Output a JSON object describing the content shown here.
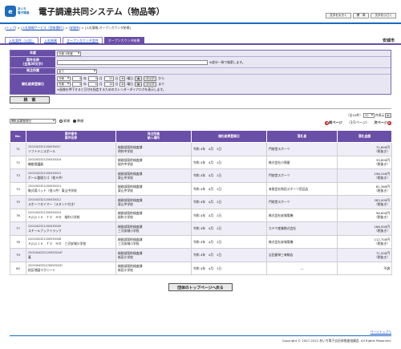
{
  "header": {
    "logo_mark": "e",
    "logo_line1": "あいち",
    "logo_line2": "電子調達",
    "system_title": "電子調達共同システム（物品等）",
    "font_buttons": [
      "文字を大きく",
      "標　準",
      "文字を小さく"
    ]
  },
  "breadcrumb": [
    {
      "label": "トップ",
      "link": true
    },
    {
      "label": "入札情報サービス（団体選択）",
      "link": true
    },
    {
      "label": "安城市",
      "link": true
    },
    {
      "label": "入札情報-オープンカウンタ結果",
      "link": false
    }
  ],
  "tabs": [
    "入札案件（公告）",
    "入札結果",
    "オープンカウンタ案件",
    "オープンカウンタ結果"
  ],
  "org_name": "安城市",
  "search": {
    "rows": [
      {
        "label": "年度",
        "value": "令和 4年度"
      },
      {
        "label": "案件名称\n(全角30文字)",
        "note": "※部分一致で検索します。"
      },
      {
        "label": "発注所属",
        "value": "全て"
      },
      {
        "label": "開札結果登録日",
        "date1": {
          "era": "令和",
          "y": "4",
          "m": "3",
          "d": "31",
          "weekday": "木",
          "suffix": "から"
        },
        "date2": {
          "era": "令和",
          "y": "4",
          "m": "4",
          "d": "14",
          "weekday": "木",
          "suffix": "まで"
        },
        "note": "※画像を押下すると日付を指定するためのカレンダーダイアログを表示します。",
        "clear": "クリア",
        "youbi": "曜日"
      }
    ],
    "button": "検　索"
  },
  "controls": {
    "sort_value": "開札結果登録日",
    "order_labels": [
      "昇順",
      "降順"
    ],
    "per_page_prefix": "（全10件）",
    "per_page_value": "10",
    "per_page_suffix": "件表示",
    "prev": "前ページ",
    "page_info": "（1/1ページ）",
    "next": "次ページ"
  },
  "table": {
    "headers": [
      "No.",
      "案件番号\n案件名称",
      "発注所属\n納入場所",
      "開札結果登録日",
      "落札者",
      "落札金額"
    ],
    "rows": [
      {
        "no": "71",
        "num": "220100232120053301?",
        "name": "ソフトテニスボール",
        "dept": "総務部契約検査課",
        "place": "明祥中学校",
        "date": "令和 4年　4月　1日",
        "winner": "門前堂スポーツ",
        "amount": "72,600円",
        "tax": "（税抜き）"
      },
      {
        "no": "72",
        "num": "2201002321200533016",
        "name": "機能保護器",
        "dept": "総務部契約検査課",
        "place": "桜井中学校",
        "date": "令和 4年　4月　1日",
        "winner": "株式会社小原屋",
        "amount": "39,800円",
        "tax": "（税抜き）"
      },
      {
        "no": "73",
        "num": "2201002321200533015",
        "name": "ボール整理カゴ（他９件）",
        "dept": "総務部契約検査課",
        "place": "東山中学校",
        "date": "令和 4年　4月　1日",
        "winner": "門前堂スポーツ",
        "amount": "196,340円",
        "tax": "（税抜き）"
      },
      {
        "no": "74",
        "num": "2201002321200533013",
        "name": "軟式用バット（他１件）東山中学校",
        "dept": "総務部契約検査課",
        "place": "東山中学校",
        "date": "令和 4年　4月　1日",
        "winner": "有限会社和田スポーツ用品店",
        "amount": "81,360円",
        "tax": "（税抜き）"
      },
      {
        "no": "75",
        "num": "2201002321200533012",
        "name": "スポーツタイマー（スタンド付き）",
        "dept": "総務部契約検査課",
        "place": "東山中学校",
        "date": "令和 4年　4月　1日",
        "winner": "門前堂スポーツ",
        "amount": "283,000円",
        "tax": "（税抜き）"
      },
      {
        "no": "76",
        "num": "2201002321200533010",
        "name": "Ａｐｐｌｅ　ＴＶ　ＨＤ　桜町小学校",
        "dept": "総務部契約検査課",
        "place": "桜町小学校",
        "date": "令和 4年　4月　1日",
        "winner": "株式会社安城電機",
        "amount": "96,600円",
        "tax": "（税抜き）"
      },
      {
        "no": "77",
        "num": "2201002321200533009",
        "name": "スチールブックトラック",
        "dept": "総務部契約検査課",
        "place": "三河安城小学校",
        "date": "令和 4年　4月　1日",
        "winner": "カミヤ産業株式会社",
        "amount": "166,000円",
        "tax": "（税抜き）"
      },
      {
        "no": "78",
        "num": "2201002321200533008",
        "name": "Ａｐｐｌｅ　ＴＶ　ＨＤ　三河安城小学校",
        "dept": "総務部契約検査課",
        "place": "三河安城小学校",
        "date": "令和 4年　4月　1日",
        "winner": "株式会社安城電機",
        "amount": "112,700円",
        "tax": "（税抜き）"
      },
      {
        "no": "79",
        "num": "2201004232120053244?",
        "name": "箒",
        "dept": "総務部契約検査課",
        "place": "新田小学校",
        "date": "令和 4年　4月　1日",
        "winner": "吉田屋琴三味線店",
        "amount": "71,000円",
        "tax": "（税抜き）"
      },
      {
        "no": "80",
        "num": "2201004232120053243?",
        "name": "校区地図マグシート",
        "dept": "総務部契約検査課",
        "place": "新田小学校",
        "date": "令和 4年　4月　1日",
        "winner": "―",
        "amount": "不調",
        "tax": ""
      }
    ]
  },
  "footer": {
    "back_button": "団体のトップページへ戻る",
    "pagetop": "ページトップへ",
    "copyright": "Copyright © 2007-2022 あいち電子自治体推進協議会. All Rights Reserved."
  },
  "colors": {
    "brand": "#1c6bbf",
    "header_purple": "#6a4fa8",
    "row_tint": "#efedf7"
  }
}
